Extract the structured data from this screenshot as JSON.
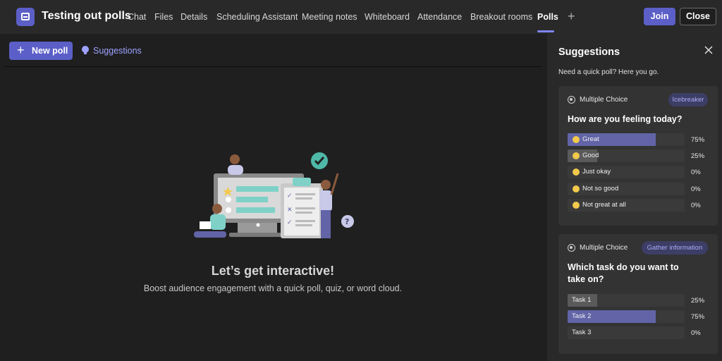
{
  "header": {
    "title": "Testing out polls",
    "tabs": [
      {
        "label": "Chat"
      },
      {
        "label": "Files"
      },
      {
        "label": "Details"
      },
      {
        "label": "Scheduling Assistant"
      },
      {
        "label": "Meeting notes"
      },
      {
        "label": "Whiteboard"
      },
      {
        "label": "Attendance"
      },
      {
        "label": "Breakout rooms"
      },
      {
        "label": "Polls",
        "active": true
      }
    ],
    "add_tab_symbol": "+",
    "join_label": "Join",
    "close_label": "Close"
  },
  "toolbar": {
    "new_poll_label": "New poll",
    "suggestions_label": "Suggestions"
  },
  "empty_state": {
    "title": "Let’s get interactive!",
    "subtitle": "Boost audience engagement with a quick poll, quiz, or word cloud."
  },
  "panel": {
    "title": "Suggestions",
    "subtitle": "Need a quick poll? Here you go.",
    "cards": [
      {
        "type": "Multiple Choice",
        "tag": "Icebreaker",
        "question": "How are you feeling today?",
        "options": [
          {
            "label": "Great",
            "percent": "75%",
            "value": 0.75,
            "emoji": true
          },
          {
            "label": "Good",
            "percent": "25%",
            "value": 0.25,
            "emoji": true
          },
          {
            "label": "Just okay",
            "percent": "0%",
            "value": 0,
            "emoji": true
          },
          {
            "label": "Not so good",
            "percent": "0%",
            "value": 0,
            "emoji": true
          },
          {
            "label": "Not great at all",
            "percent": "0%",
            "value": 0,
            "emoji": true
          }
        ]
      },
      {
        "type": "Multiple Choice",
        "tag": "Gather information",
        "question": "Which task do you want to take on?",
        "options": [
          {
            "label": "Task 1",
            "percent": "25%",
            "value": 0.25,
            "emoji": false
          },
          {
            "label": "Task 2",
            "percent": "75%",
            "value": 0.75,
            "emoji": false
          },
          {
            "label": "Task 3",
            "percent": "0%",
            "value": 0,
            "emoji": false
          }
        ]
      }
    ]
  },
  "colors": {
    "accent": "#5b5fc7",
    "accent_light": "#7f85f5",
    "bar_fill": "#6264a7",
    "background": "#1f1f1f",
    "panel": "#292929"
  }
}
